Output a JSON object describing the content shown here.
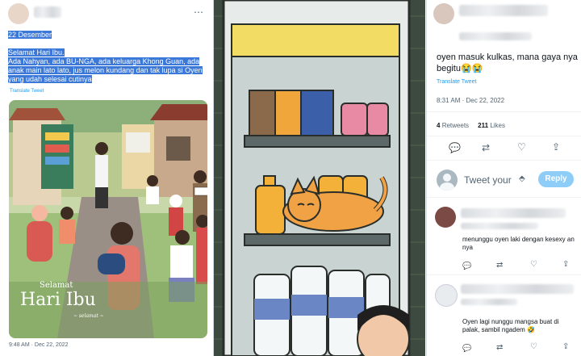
{
  "left_tweet": {
    "date_line": "22 Desember",
    "greeting": "Selamat Hari Ibu.",
    "body": "Ada Nahyan, ada BU-NGA, ada keluarga Khong Guan, ada anak main lato lato, jus melon kundang dan tak lupa si Oyen yang udah selesai cutinya",
    "translate": "Translate Tweet",
    "image_title_small": "Selamat",
    "image_title_big": "Hari Ibu",
    "image_sign": "~ selamat ~",
    "timestamp": "9:48 AM · Dec 22, 2022"
  },
  "right_tweet": {
    "body": "oyen masuk kulkas, mana gaya nya begitu😭😭",
    "translate": "Translate Tweet",
    "timestamp": "8:31 AM · Dec 22, 2022",
    "retweets_count": "4",
    "retweets_label": "Retweets",
    "likes_count": "211",
    "likes_label": "Likes",
    "reply_placeholder": "Tweet your",
    "reply_button": "Reply",
    "reply1_text": "menunggu oyen laki dengan kesexy an nya",
    "reply2_text": "Oyen lagi nunggu mangsa buat di palak, sambil ngadem 🤣"
  },
  "icons": [
    "reply-icon",
    "retweet-icon",
    "like-icon",
    "share-icon"
  ],
  "colors": {
    "selection": "#3b78d8",
    "link": "#1d9bf0",
    "reply_button": "#8ecdf8"
  }
}
